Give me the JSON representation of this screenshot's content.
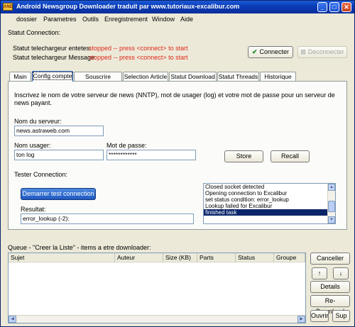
{
  "window": {
    "title": "Android Newsgroup Downloader traduit par www.tutoriaux-excalibur.com",
    "app_icon_text": "AND",
    "minimize": "_",
    "maximize": "□",
    "close": "✕"
  },
  "menu": [
    "dossier",
    "Parametres",
    "Outils",
    "Enregistrement",
    "Window",
    "Aide"
  ],
  "status": {
    "section_label": "Statut Connection:",
    "headers_label": "Statut telechargeur entetes:",
    "headers_value": "stopped -- press <connect> to start",
    "message_label": "Statut telechargeur Message:",
    "message_value": "stopped -- press <connect> to start",
    "connect_label": "Connecter",
    "disconnect_label": "Deconnecter"
  },
  "tabs": [
    "Main",
    "Config compte",
    "Souscrire Groupe",
    "Selection Article",
    "Statut Download",
    "Statut Threads",
    "Historique"
  ],
  "active_tab": 1,
  "config": {
    "intro": "Inscrivez le nom de votre serveur de news (NNTP), mot de usager (log) et votre mot de passe pour un serveur de news payant.",
    "server_label": "Nom du serveur:",
    "server_value": "news.astraweb.com",
    "user_label": "Nom usager:",
    "user_value": "ton log",
    "password_label": "Mot de passe:",
    "password_value": "************",
    "store_label": "Store",
    "recall_label": "Recall",
    "test_label": "Tester Connection:",
    "test_button_label": "Demarrer test connection",
    "result_label": "Resultat:",
    "result_value": "error_lookup (-2):",
    "log": [
      "Closed socket detected",
      "Opening connection to Excalibur",
      "set status condition: error_lookup",
      "Lookup failed for Excalibur",
      "finished task"
    ],
    "log_selected_index": 4
  },
  "queue": {
    "label": "Queue - \"Creer la Liste\" - items a etre downloader:",
    "columns": [
      "Sujet",
      "Auteur",
      "Size (KB)",
      "Parts",
      "Status",
      "Groupe"
    ],
    "rows": []
  },
  "actions": {
    "cancel": "Canceller",
    "up": "↑",
    "down": "↓",
    "details": "Details",
    "redownload": "Re-Download",
    "open": "Ouvrir",
    "delete": "Sup"
  },
  "colors": {
    "title_bar": "#0a3db8",
    "status_text": "#e0281a",
    "selection": "#0a246a",
    "primary_button": "#1f58c0"
  }
}
